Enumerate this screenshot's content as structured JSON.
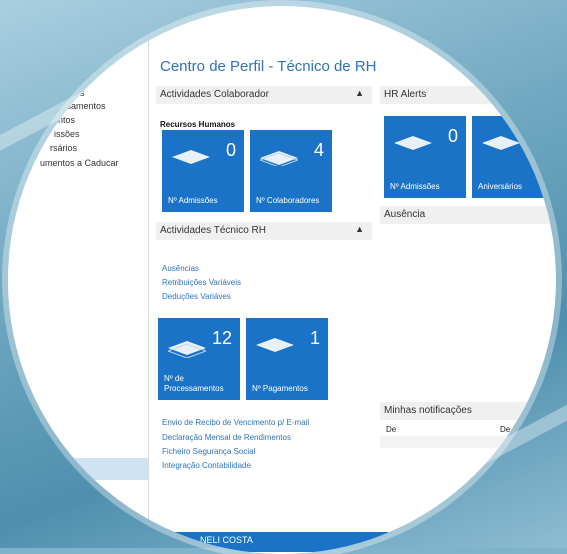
{
  "page": {
    "title": "Centro de Perfil - Técnico de RH"
  },
  "left_nav": {
    "items": [
      "s",
      "ssamentos",
      "ntos",
      "issões",
      "rsários",
      "umentos a Caducar"
    ]
  },
  "activities_colaborador": {
    "header": "Actividades Colaborador",
    "subheader": "Recursos Humanos",
    "tiles": [
      {
        "value": "0",
        "label": "Nº Admissões"
      },
      {
        "value": "4",
        "label": "Nº Colaboradores"
      }
    ]
  },
  "activities_tecnico": {
    "header": "Actividades Técnico RH",
    "links": [
      "Ausências",
      "Retribuições Variáveis",
      "Deduções Variáves"
    ],
    "tiles": [
      {
        "value": "12",
        "label_line1": "Nº de",
        "label_line2": "Processamentos"
      },
      {
        "value": "1",
        "label": "Nº Pagamentos"
      }
    ],
    "links2": [
      "Envio de Recibo de Vencimento p/ E-mail",
      "Declaração Mensal de Rendimentos",
      "Ficheiro Segurança Social",
      "Integração Contabilidade"
    ]
  },
  "hr_alerts": {
    "header": "HR Alerts",
    "tiles": [
      {
        "value": "0",
        "label": "Nº Admissões"
      },
      {
        "value": "",
        "label": "Aniversários"
      }
    ]
  },
  "ausencia": {
    "header": "Ausência"
  },
  "notificacoes": {
    "header": "Minhas notificações",
    "col1": "De",
    "col2": "De"
  },
  "bottom_bar": {
    "user": "NELI COSTA"
  },
  "colors": {
    "accent": "#1a73c6",
    "link": "#2e73b8"
  }
}
